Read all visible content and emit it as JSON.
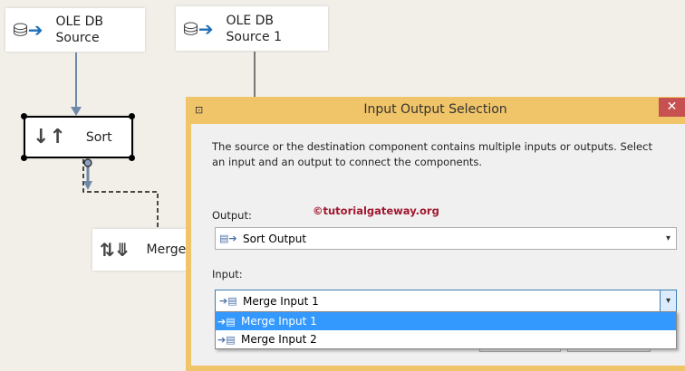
{
  "canvas": {
    "nodes": {
      "source": [
        "OLE DB",
        "Source"
      ],
      "source1": [
        "OLE DB",
        "Source 1"
      ],
      "sort": "Sort",
      "merge": "Merge"
    }
  },
  "dialog": {
    "title": "Input Output Selection",
    "close": "✕",
    "description": "The source or the destination component contains multiple inputs or outputs. Select an input and an output to connect the components.",
    "watermark": "©tutorialgateway.org",
    "output_label": "Output:",
    "output_value": "Sort Output",
    "input_label": "Input:",
    "input_value": "Merge Input 1",
    "input_options": [
      "Merge Input 1",
      "Merge Input 2"
    ],
    "accent": "#3399ff"
  }
}
